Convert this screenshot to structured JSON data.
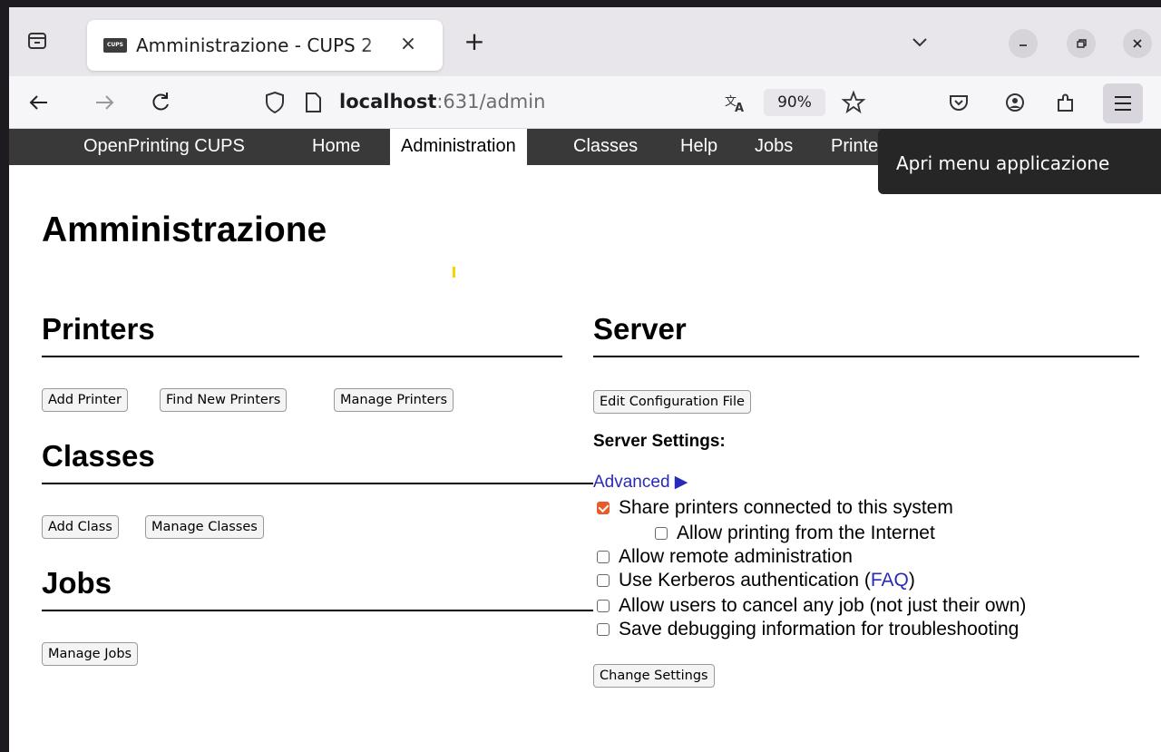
{
  "browser": {
    "tab": {
      "title": "Amministrazione - CUPS 2",
      "favicon_text": "CUPS"
    },
    "url": {
      "host": "localhost",
      "path": ":631/admin"
    },
    "zoom": "90%",
    "tooltip": "Apri menu applicazione"
  },
  "cups_nav": {
    "brand": "OpenPrinting CUPS",
    "items": [
      "Home",
      "Administration",
      "Classes",
      "Help",
      "Jobs",
      "Printers"
    ],
    "active": "Administration"
  },
  "page": {
    "title": "Amministrazione",
    "printers": {
      "heading": "Printers",
      "buttons": [
        "Add Printer",
        "Find New Printers",
        "Manage Printers"
      ]
    },
    "classes": {
      "heading": "Classes",
      "buttons": [
        "Add Class",
        "Manage Classes"
      ]
    },
    "jobs": {
      "heading": "Jobs",
      "buttons": [
        "Manage Jobs"
      ]
    },
    "server": {
      "heading": "Server",
      "edit_button": "Edit Configuration File",
      "settings_label": "Server Settings:",
      "advanced_link": "Advanced ▶",
      "options": [
        {
          "label": "Share printers connected to this system",
          "checked": true
        },
        {
          "label": "Allow printing from the Internet",
          "checked": false
        },
        {
          "label": "Allow remote administration",
          "checked": false
        },
        {
          "label": "Use Kerberos authentication (",
          "link": "FAQ",
          "suffix": ")",
          "checked": false
        },
        {
          "label": "Allow users to cancel any job (not just their own)",
          "checked": false
        },
        {
          "label": "Save debugging information for troubleshooting",
          "checked": false
        }
      ],
      "change_button": "Change Settings"
    }
  },
  "colors": {
    "cups_header_bg": "#393939",
    "checkbox_accent": "#ea5a28",
    "link": "#2a2ab8"
  }
}
